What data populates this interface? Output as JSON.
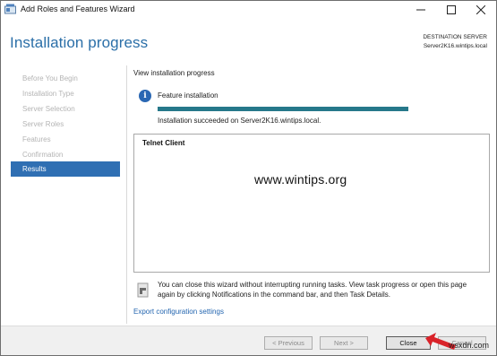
{
  "window": {
    "title": "Add Roles and Features Wizard",
    "minimize_icon": "minimize-icon",
    "maximize_icon": "maximize-icon",
    "close_icon": "close-icon"
  },
  "header": {
    "title": "Installation progress",
    "destination_label": "DESTINATION SERVER",
    "destination_server": "Server2K16.wintips.local"
  },
  "sidebar": {
    "items": [
      {
        "label": "Before You Begin",
        "active": false
      },
      {
        "label": "Installation Type",
        "active": false
      },
      {
        "label": "Server Selection",
        "active": false
      },
      {
        "label": "Server Roles",
        "active": false
      },
      {
        "label": "Features",
        "active": false
      },
      {
        "label": "Confirmation",
        "active": false
      },
      {
        "label": "Results",
        "active": true
      }
    ],
    "active_color": "#2f6fb3"
  },
  "main": {
    "view_label": "View installation progress",
    "status_icon": "info-icon",
    "feature_label": "Feature installation",
    "progress": 1.0,
    "progress_color": "#26788a",
    "success_text": "Installation succeeded on Server2K16.wintips.local.",
    "results": {
      "items": [
        "Telnet Client"
      ],
      "watermark": "www.wintips.org"
    },
    "note_icon": "flag-note-icon",
    "note_text": "You can close this wizard without interrupting running tasks. View task progress or open this page again by clicking Notifications in the command bar, and then Task Details.",
    "export_link": "Export configuration settings"
  },
  "footer": {
    "previous_label": "< Previous",
    "next_label": "Next >",
    "close_label": "Close",
    "cancel_label": "Cancel"
  },
  "overlay": {
    "site_mark": "wsxdn.com",
    "arrow_icon": "red-arrow-icon"
  }
}
